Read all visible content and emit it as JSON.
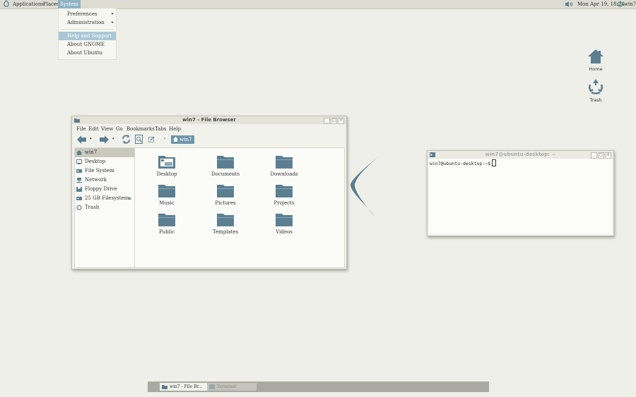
{
  "top_panel": {
    "menus": [
      "Applications",
      "Places",
      "System"
    ],
    "active_menu": "System",
    "clock": "Mon Apr 19, 18:24",
    "user": "win7"
  },
  "system_menu": {
    "items": [
      {
        "label": "Preferences",
        "submenu": true
      },
      {
        "label": "Administration",
        "submenu": true
      },
      {
        "label": "Help and Support",
        "highlighted": true
      },
      {
        "label": "About GNOME"
      },
      {
        "label": "About Ubuntu"
      }
    ]
  },
  "desktop_icons": [
    {
      "label": "Home",
      "icon": "home-icon"
    },
    {
      "label": "Trash",
      "icon": "recycle-icon"
    }
  ],
  "file_browser": {
    "title": "win7 - File Browser",
    "menu": [
      "File",
      "Edit",
      "View",
      "Go",
      "Bookmarks",
      "Tabs",
      "Help"
    ],
    "location": "win7",
    "sidebar": [
      {
        "label": "win7",
        "icon": "home-icon",
        "selected": true
      },
      {
        "label": "Desktop",
        "icon": "desktop-icon"
      },
      {
        "label": "File System",
        "icon": "drive-icon"
      },
      {
        "label": "Network",
        "icon": "network-icon"
      },
      {
        "label": "Floppy Drive",
        "icon": "floppy-icon"
      },
      {
        "label": "25 GB Filesystem",
        "icon": "drive-icon",
        "eject": true
      },
      {
        "label": "Trash",
        "icon": "trash-icon"
      }
    ],
    "folders": [
      "Desktop",
      "Documents",
      "Downloads",
      "Music",
      "Pictures",
      "Projects",
      "Public",
      "Templates",
      "Videos"
    ]
  },
  "terminal": {
    "title": "win7@ubuntu-desktop: ~",
    "prompt": "win7@ubuntu-desktop:~$"
  },
  "taskbar": {
    "tasks": [
      {
        "label": "win7 - File Br...",
        "active": true
      },
      {
        "label": "Terminal",
        "active": false
      }
    ]
  },
  "colors": {
    "accent": "#6f95a8",
    "panel": "#dcdcd2",
    "desktop": "#efefea"
  }
}
